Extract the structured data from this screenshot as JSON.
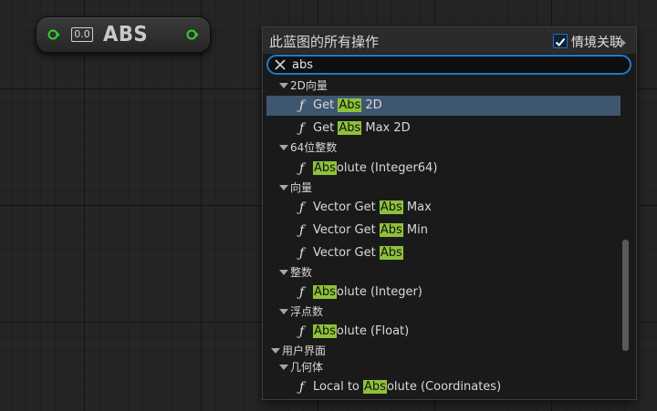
{
  "node": {
    "badge": "0.0",
    "title": "ABS",
    "pin_color": "#33d12f"
  },
  "menu": {
    "title": "此蓝图的所有操作",
    "context_label": "情境关联",
    "context_checked": true,
    "search_value": "abs",
    "highlight_color": "#8ec13a",
    "items": [
      {
        "kind": "category",
        "level": 1,
        "label": "2D向量"
      },
      {
        "kind": "function",
        "level": 1,
        "pre": "Get ",
        "match": "Abs",
        "post": " 2D",
        "selected": true
      },
      {
        "kind": "function",
        "level": 1,
        "pre": "Get ",
        "match": "Abs",
        "post": " Max 2D"
      },
      {
        "kind": "category",
        "level": 1,
        "label": "64位整数"
      },
      {
        "kind": "function",
        "level": 1,
        "pre": "",
        "match": "Abs",
        "post": "olute (Integer64)"
      },
      {
        "kind": "category",
        "level": 1,
        "label": "向量"
      },
      {
        "kind": "function",
        "level": 1,
        "pre": "Vector Get ",
        "match": "Abs",
        "post": " Max"
      },
      {
        "kind": "function",
        "level": 1,
        "pre": "Vector Get ",
        "match": "Abs",
        "post": " Min"
      },
      {
        "kind": "function",
        "level": 1,
        "pre": "Vector Get ",
        "match": "Abs",
        "post": ""
      },
      {
        "kind": "category",
        "level": 1,
        "label": "整数"
      },
      {
        "kind": "function",
        "level": 1,
        "pre": "",
        "match": "Abs",
        "post": "olute (Integer)"
      },
      {
        "kind": "category",
        "level": 1,
        "label": "浮点数"
      },
      {
        "kind": "function",
        "level": 1,
        "pre": "",
        "match": "Abs",
        "post": "olute (Float)"
      },
      {
        "kind": "category",
        "level": 0,
        "label": "用户界面"
      },
      {
        "kind": "category",
        "level": 1,
        "label": "几何体"
      },
      {
        "kind": "function",
        "level": 1,
        "pre": "Local to ",
        "match": "Abs",
        "post": "olute (Coordinates)"
      }
    ]
  }
}
